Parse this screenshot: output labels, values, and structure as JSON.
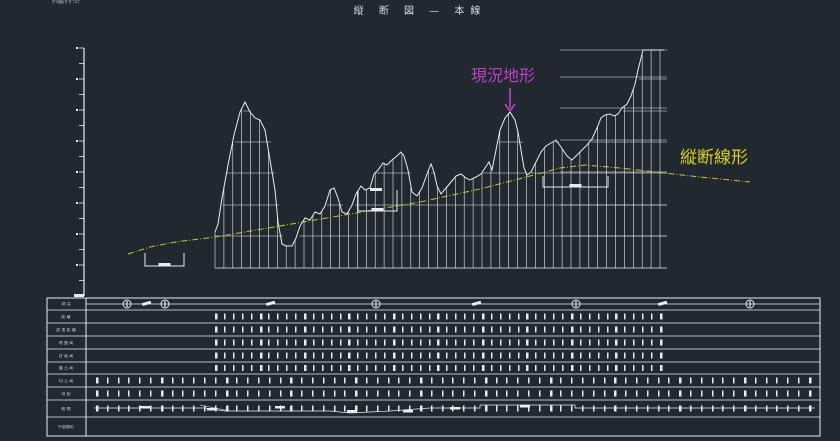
{
  "drawing": {
    "title": "縦 断 図 — 本線",
    "annotations": {
      "terrain_label": "現況地形",
      "alignment_label": "縦断線形"
    },
    "colors": {
      "background": "#212830",
      "lines": "#e8ecef",
      "terrain_label": "#c040c8",
      "alignment": "#c8c832"
    },
    "table_rows": [
      {
        "id": "r0",
        "label": "測 点"
      },
      {
        "id": "r1",
        "label": "距 離"
      },
      {
        "id": "r2",
        "label": "追 加 距 離"
      },
      {
        "id": "r3",
        "label": "地 盤 高"
      },
      {
        "id": "r4",
        "label": "計 画 高"
      },
      {
        "id": "r5",
        "label": "盛 土 高"
      },
      {
        "id": "r6",
        "label": "切 土 高"
      },
      {
        "id": "r7",
        "label": "勾 配"
      },
      {
        "id": "r8",
        "label": "曲 線"
      },
      {
        "id": "r9",
        "label": "平面線形"
      },
      {
        "id": "r10",
        "label": "片勾配すりつけ"
      }
    ]
  }
}
